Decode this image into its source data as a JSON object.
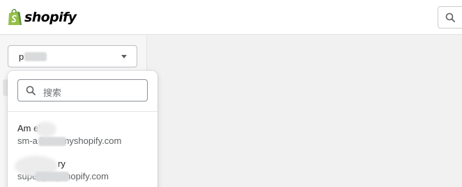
{
  "brand": {
    "name": "shopify"
  },
  "header": {
    "search_icon": "search-icon"
  },
  "store_selector": {
    "selected_label": "p e"
  },
  "dropdown": {
    "search_placeholder": "搜索",
    "stores": [
      {
        "name": "Am ebe",
        "domain": "sm-a liebe.myshopify.com"
      },
      {
        "name": "ry",
        "domain": "supe ry.myshopify.com"
      }
    ]
  },
  "colors": {
    "brand_green": "#95bf47",
    "brand_dark_green": "#5e8e3e",
    "sidebar_bg": "#f6f6f7",
    "main_bg": "#f1f1f1"
  }
}
